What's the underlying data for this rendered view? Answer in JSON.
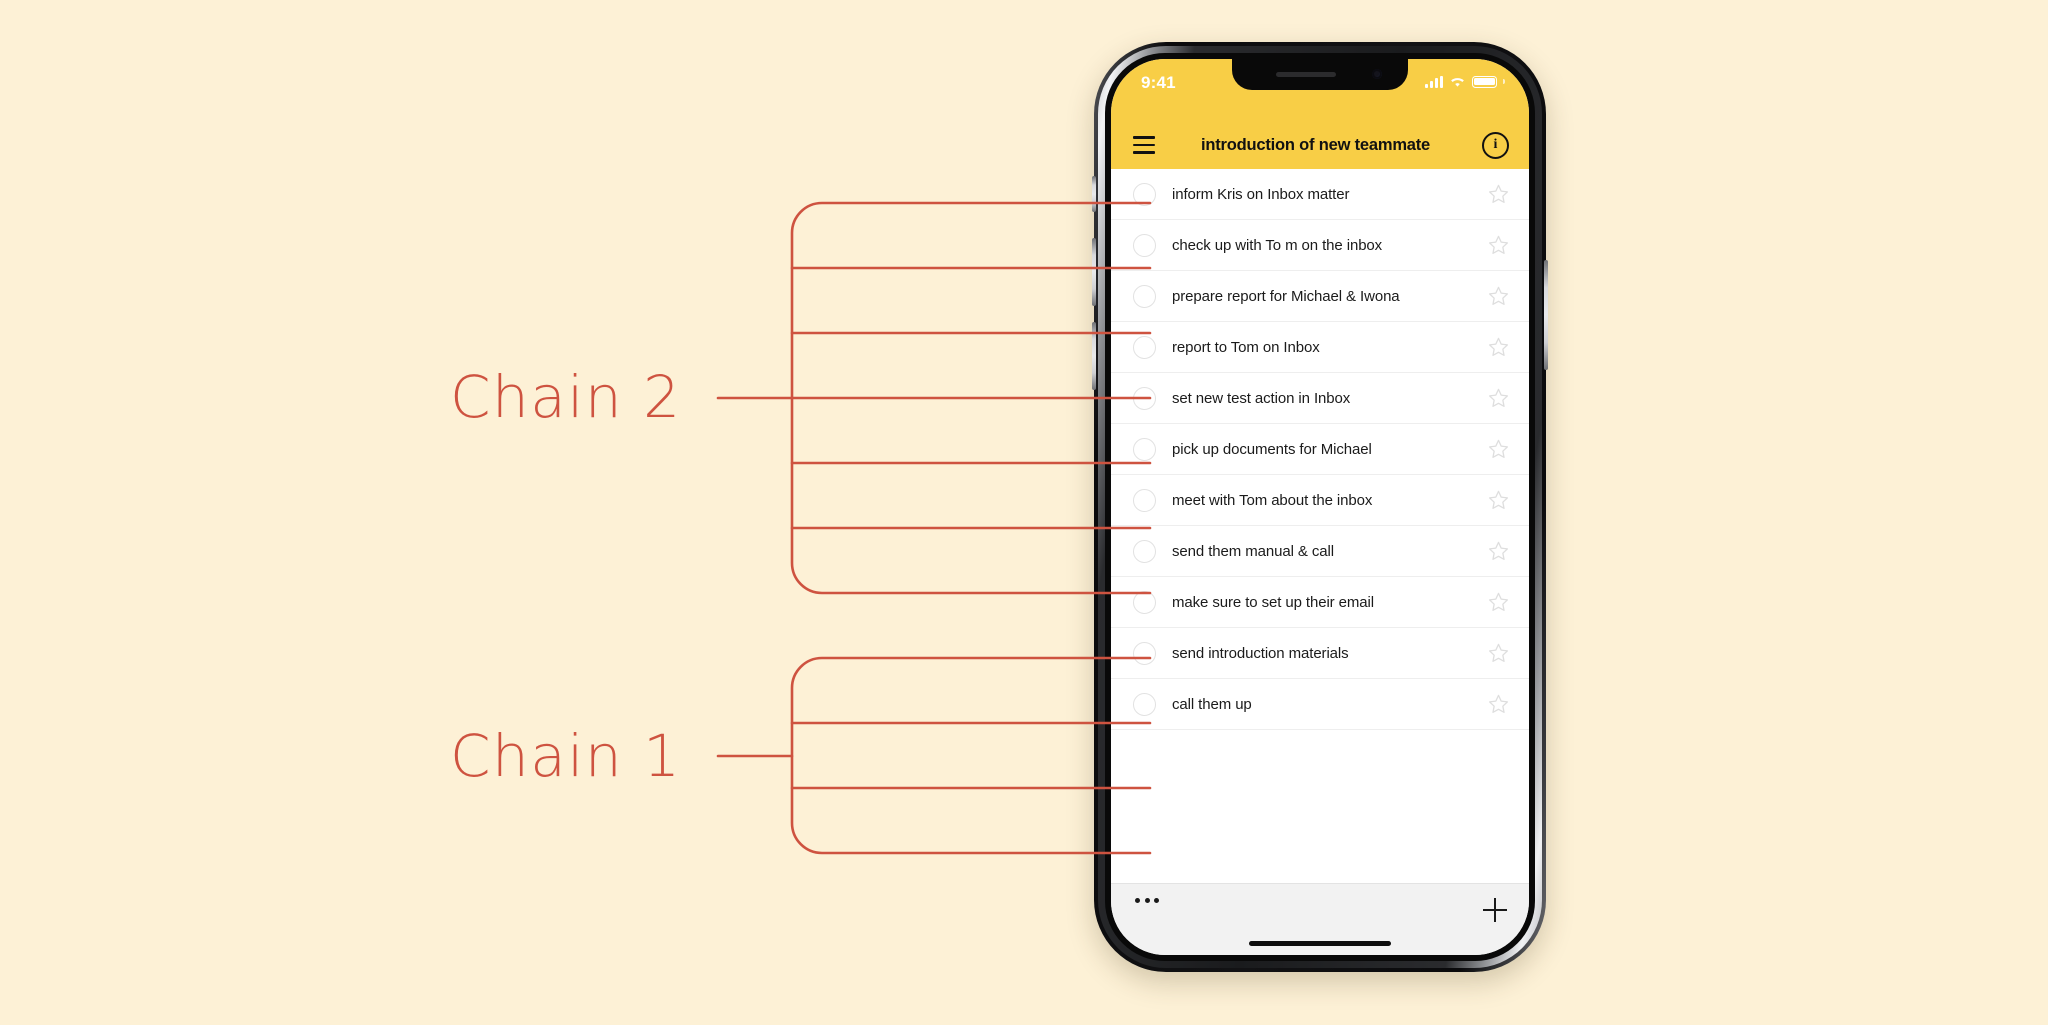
{
  "page": {
    "background_color": "#FDF1D6",
    "annotation_color": "#CE5340"
  },
  "annotations": {
    "chains": [
      {
        "id": "chain-2",
        "label": "Chain 2",
        "task_indices": [
          0,
          1,
          2,
          3,
          4,
          5,
          6
        ]
      },
      {
        "id": "chain-1",
        "label": "Chain 1",
        "task_indices": [
          7,
          8,
          9,
          10
        ]
      }
    ]
  },
  "phone": {
    "status_bar": {
      "time": "9:41",
      "signal_icon": "cellular-signal-icon",
      "wifi_icon": "wifi-icon",
      "battery_icon": "battery-full-icon"
    },
    "app": {
      "header": {
        "menu_icon": "hamburger-menu-icon",
        "title": "introduction of new teammate",
        "info_icon": "info-circle-icon",
        "background_color": "#F8CE46"
      },
      "tasks": [
        {
          "text": "inform Kris on Inbox matter",
          "checked": false,
          "starred": false
        },
        {
          "text": "check up with To m on the inbox",
          "checked": false,
          "starred": false
        },
        {
          "text": "prepare report for Michael & Iwona",
          "checked": false,
          "starred": false
        },
        {
          "text": "report to Tom on Inbox",
          "checked": false,
          "starred": false
        },
        {
          "text": "set new test action in Inbox",
          "checked": false,
          "starred": false
        },
        {
          "text": "pick up documents for Michael",
          "checked": false,
          "starred": false
        },
        {
          "text": "meet with Tom about the inbox",
          "checked": false,
          "starred": false
        },
        {
          "text": "send them manual & call",
          "checked": false,
          "starred": false
        },
        {
          "text": "make sure to set up their email",
          "checked": false,
          "starred": false
        },
        {
          "text": "send introduction materials",
          "checked": false,
          "starred": false
        },
        {
          "text": "call them up",
          "checked": false,
          "starred": false
        }
      ],
      "toolbar": {
        "more_icon": "ellipsis-icon",
        "add_icon": "plus-icon"
      }
    }
  }
}
